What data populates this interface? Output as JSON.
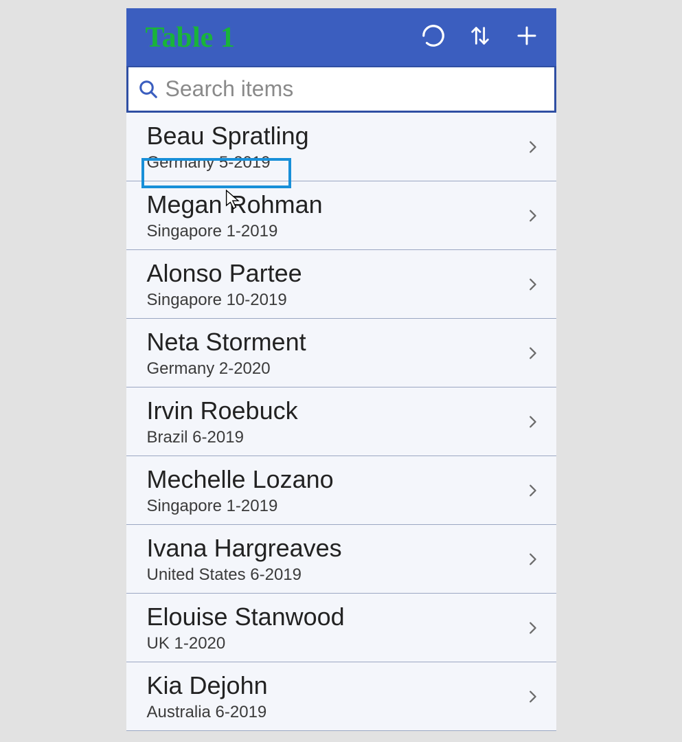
{
  "header": {
    "title": "Table 1"
  },
  "search": {
    "placeholder": "Search items",
    "value": ""
  },
  "rows": [
    {
      "name": "Beau Spratling",
      "sub": "Germany 5-2019"
    },
    {
      "name": "Megan Rohman",
      "sub": "Singapore 1-2019"
    },
    {
      "name": "Alonso Partee",
      "sub": "Singapore 10-2019"
    },
    {
      "name": "Neta Storment",
      "sub": "Germany 2-2020"
    },
    {
      "name": "Irvin Roebuck",
      "sub": "Brazil 6-2019"
    },
    {
      "name": "Mechelle Lozano",
      "sub": "Singapore 1-2019"
    },
    {
      "name": "Ivana Hargreaves",
      "sub": "United States 6-2019"
    },
    {
      "name": "Elouise Stanwood",
      "sub": "UK 1-2020"
    },
    {
      "name": "Kia Dejohn",
      "sub": "Australia 6-2019"
    }
  ],
  "colors": {
    "header_bg": "#3b5ebf",
    "title_green": "#19b43a",
    "highlight_blue": "#188fd8"
  }
}
